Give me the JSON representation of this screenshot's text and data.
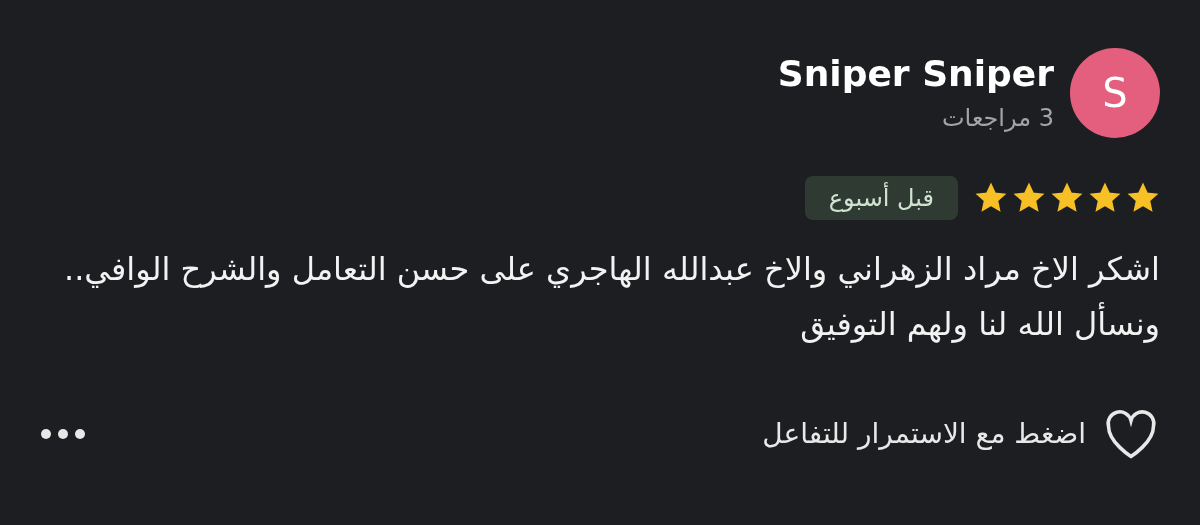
{
  "reviewer": {
    "initial": "S",
    "name": "Sniper Sniper",
    "reviews_count": "3 مراجعات"
  },
  "review": {
    "stars": 5,
    "time": "قبل أسبوع",
    "text": "اشكر الاخ مراد الزهراني والاخ عبدالله الهاجري على حسن التعامل والشرح الوافي.. ونسأل الله لنا ولهم التوفيق"
  },
  "reaction": {
    "hint": "اضغط مع الاستمرار للتفاعل",
    "liked": false
  }
}
